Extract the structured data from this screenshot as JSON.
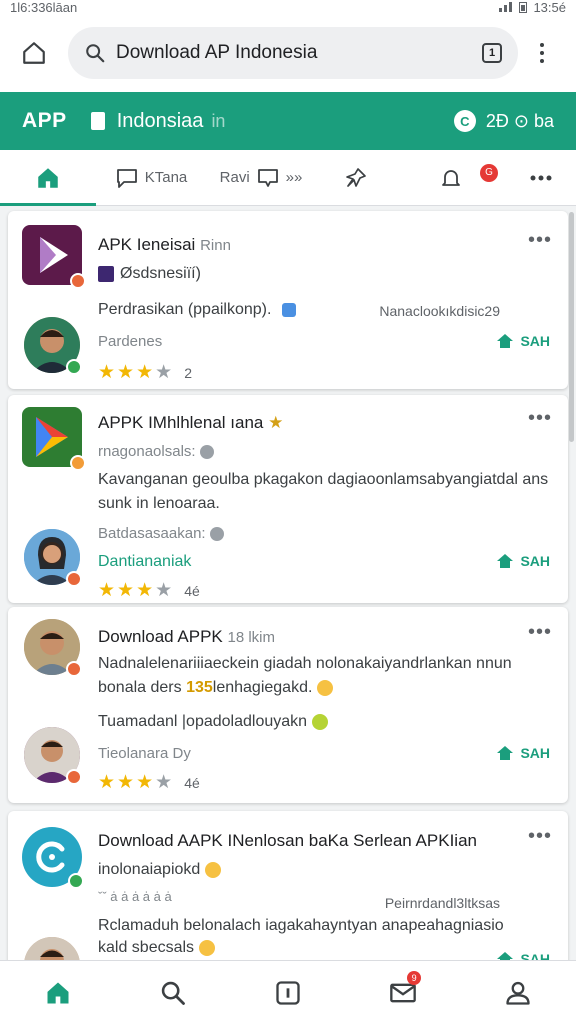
{
  "status_bar": {
    "left_text": "1l6:336lāan",
    "time": "13:5é"
  },
  "browser": {
    "url_text": "Download AP Indonesia",
    "tab_count": "1"
  },
  "app_header": {
    "brand": "APP",
    "region": "Indonsiaa",
    "region_suffix": "in",
    "badge": "C",
    "right_text": "2Ð ⊙ ba"
  },
  "tabs": [
    {
      "label": "",
      "icon": "home-icon"
    },
    {
      "label": "KTana",
      "icon": "chat-icon"
    },
    {
      "label": "Ravi",
      "suffix": "»»",
      "icon": "message-icon"
    },
    {
      "label": "",
      "icon": "pin-icon"
    },
    {
      "label": "",
      "icon": "bell-icon",
      "badge": "G"
    },
    {
      "label": "",
      "icon": "more-icon"
    }
  ],
  "cards": [
    {
      "title": "APK Ieneisai",
      "title_suffix": "Rinn",
      "publisher": "Øsdsnesiïí)",
      "line1": "Perdrasikan (ppailkonp).",
      "line1_right": "Nanaclookıkdisic29",
      "line2": "Pardenes",
      "save_label": "SAH",
      "rating_count": "2",
      "stars": 3
    },
    {
      "title": "APPK IMhlhlenal ıana",
      "subtitle": "rnagonaolsals:",
      "body_1": "Kavanganan geoulba pkagakon dagiaoonlamsabyangiatdal ans",
      "body_2": "sunk in lenoaraa.",
      "line2": "Batdasasaakan:",
      "line3": "Dantiananiak",
      "save_label": "SAH",
      "rating_count": "4é",
      "stars": 3
    },
    {
      "title": "Download APPK",
      "title_suffix": "18 lkim",
      "body_1": "Nadnalelenariiiaeckein giadah nolonakaiyandrlankan nnun",
      "body_2_pre": "bonala ders",
      "body_2_hl": "135",
      "body_2_post": "lenhagiegakd.",
      "line2": "Tuamadanl |opadoladlouyakn",
      "line3": "Tieolanara Dy",
      "save_label": "SAH",
      "rating_count": "4é",
      "stars": 3
    },
    {
      "title": "Download AAPK INenlosan baKa Serlean APKIian",
      "subtitle": "inolonaiapiokd",
      "meta_left": "ˇˇ ȧ ȧ ȧ ȧ ȧ ȧ",
      "meta_right": "Peirnrdandl3ltksas",
      "body_1": "Rclamaduh belonalach iagakahayntyan anapeahagniasio",
      "body_2": "kald sbecsals",
      "save_label": "SAH"
    }
  ],
  "colors": {
    "accent": "#1b9e7d",
    "star": "#f2b705",
    "badge_red": "#e53935"
  },
  "bottom_nav": [
    "home-icon",
    "search-icon",
    "tabs-icon",
    "mail-icon",
    "profile-icon"
  ],
  "bottom_nav_badge": "9"
}
